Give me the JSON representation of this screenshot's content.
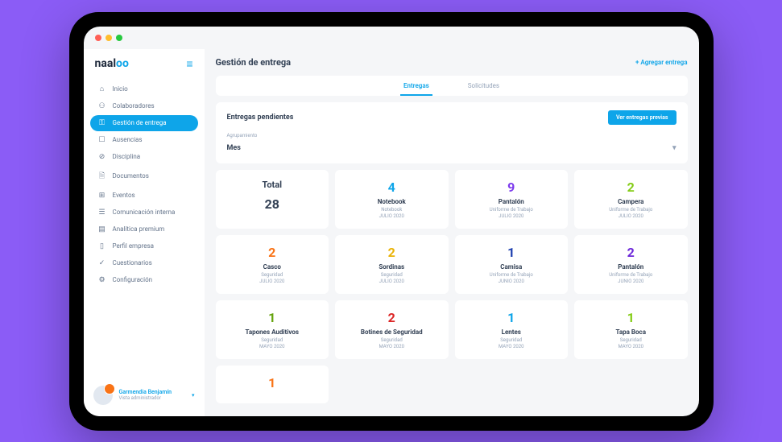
{
  "logo": {
    "text_a": "naal",
    "text_b": "oo"
  },
  "nav": [
    {
      "icon": "⌂",
      "label": "Inicio"
    },
    {
      "icon": "⚇",
      "label": "Colaboradores"
    },
    {
      "icon": "⚿",
      "label": "Gestión de entrega",
      "active": true
    },
    {
      "icon": "☐",
      "label": "Ausencias"
    },
    {
      "icon": "⊘",
      "label": "Disciplina"
    },
    {
      "icon": "🗎",
      "label": "Documentos"
    },
    {
      "icon": "⊞",
      "label": "Eventos"
    },
    {
      "icon": "☰",
      "label": "Comunicación interna"
    },
    {
      "icon": "▤",
      "label": "Analítica premium"
    },
    {
      "icon": "▯",
      "label": "Perfil empresa"
    },
    {
      "icon": "✓",
      "label": "Cuestionarios"
    },
    {
      "icon": "⚙",
      "label": "Configuración"
    }
  ],
  "user": {
    "name": "Garmendia Benjamín",
    "role": "Vista administrador"
  },
  "header": {
    "title": "Gestión de entrega",
    "add": "+  Agregar entrega"
  },
  "tabs": [
    {
      "label": "Entregas",
      "active": true
    },
    {
      "label": "Solicitudes"
    }
  ],
  "section": {
    "title": "Entregas pendientes",
    "view_btn": "Ver entregas previas",
    "group_label": "Agrupamiento",
    "group_value": "Mes"
  },
  "total": {
    "label": "Total",
    "value": "28"
  },
  "cards": [
    {
      "num": "4",
      "title": "Notebook",
      "sub": "Notebook",
      "date": "JULIO 2020",
      "color": "c-blue"
    },
    {
      "num": "9",
      "title": "Pantalón",
      "sub": "Uniforme de Trabajo",
      "date": "JULIO 2020",
      "color": "c-purple"
    },
    {
      "num": "2",
      "title": "Campera",
      "sub": "Uniforme de Trabajo",
      "date": "JULIO 2020",
      "color": "c-green"
    },
    {
      "num": "2",
      "title": "Casco",
      "sub": "Seguridad",
      "date": "JULIO 2020",
      "color": "c-orange"
    },
    {
      "num": "2",
      "title": "Sordinas",
      "sub": "Seguridad",
      "date": "JULIO 2020",
      "color": "c-yellow"
    },
    {
      "num": "1",
      "title": "Camisa",
      "sub": "Uniforme de Trabajo",
      "date": "JUNIO 2020",
      "color": "c-dblue"
    },
    {
      "num": "2",
      "title": "Pantalón",
      "sub": "Uniforme de Trabajo",
      "date": "JUNIO 2020",
      "color": "c-dpurple"
    },
    {
      "num": "1",
      "title": "Tapones Auditivos",
      "sub": "Seguridad",
      "date": "MAYO 2020",
      "color": "c-lgreen"
    },
    {
      "num": "2",
      "title": "Botines de Seguridad",
      "sub": "Seguridad",
      "date": "MAYO 2020",
      "color": "c-red"
    },
    {
      "num": "1",
      "title": "Lentes",
      "sub": "Seguridad",
      "date": "MAYO 2020",
      "color": "c-blue"
    },
    {
      "num": "1",
      "title": "Tapa Boca",
      "sub": "Seguridad",
      "date": "MAYO 2020",
      "color": "c-green"
    },
    {
      "num": "1",
      "title": "",
      "sub": "",
      "date": "",
      "color": "c-orange"
    }
  ]
}
